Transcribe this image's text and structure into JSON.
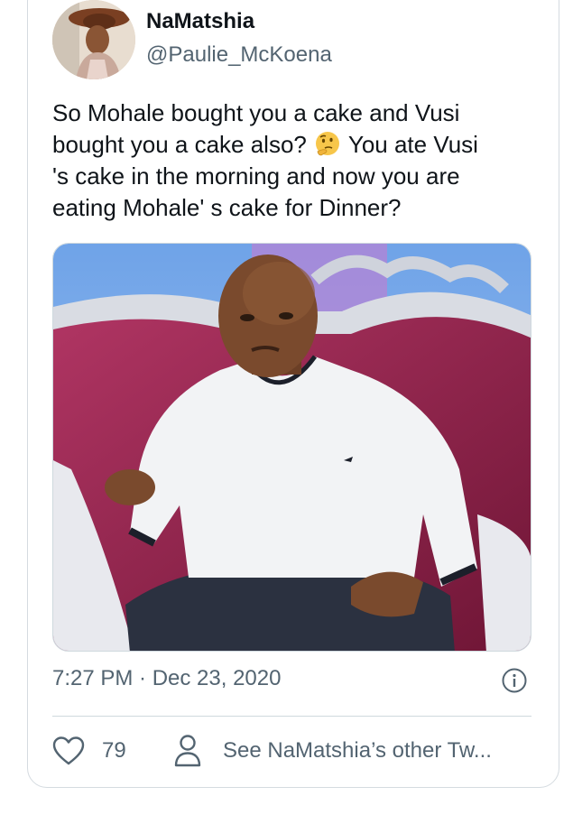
{
  "tweet": {
    "display_name": "NaMatshia",
    "handle": "@Paulie_McKoena",
    "text_lines": [
      "So Mohale bought you a cake and Vusi",
      "bought you a cake also?",
      "You ate Vusi",
      "'s cake in the morning and now you are",
      "eating Mohale' s cake for Dinner?"
    ],
    "emoji": "thinking-face",
    "timestamp": "7:27 PM · Dec 23, 2020",
    "like_count": "79",
    "see_other_label": "See NaMatshia’s other Tw..."
  },
  "icons": {
    "like": "heart-icon",
    "profile": "person-icon",
    "info": "info-icon"
  },
  "colors": {
    "text_primary": "#0f1419",
    "text_secondary": "#536471",
    "border": "#cfd9de"
  }
}
